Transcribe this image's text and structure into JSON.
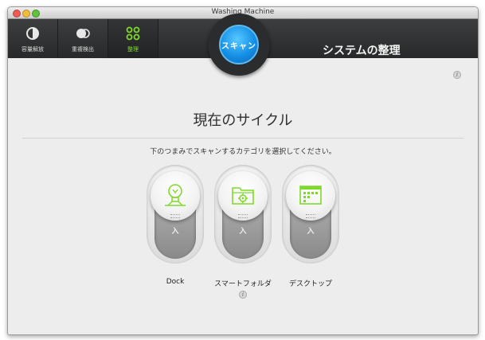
{
  "window": {
    "title": "Washing Machine"
  },
  "toolbar": {
    "items": [
      {
        "label": "容量解放",
        "icon": "moon-gauge-icon",
        "active": false
      },
      {
        "label": "重複検出",
        "icon": "duplicate-circles-icon",
        "active": false
      },
      {
        "label": "整理",
        "icon": "organize-dots-icon",
        "active": true
      }
    ],
    "section_title": "システムの整理"
  },
  "scan_button": {
    "label": "スキャン"
  },
  "main": {
    "heading": "現在のサイクル",
    "instruction": "下のつまみでスキャンするカテゴリを選択してください。",
    "switches": [
      {
        "label": "Dock",
        "state": "入",
        "icon": "lightbulb-icon"
      },
      {
        "label": "スマートフォルダ",
        "state": "入",
        "icon": "smart-folder-icon"
      },
      {
        "label": "デスクトップ",
        "state": "入",
        "icon": "desktop-icon"
      }
    ]
  },
  "info_glyph": "i",
  "colors": {
    "accent_green": "#7fd92c",
    "scan_blue": "#1590e6",
    "toolbar_dark": "#2e3031"
  }
}
